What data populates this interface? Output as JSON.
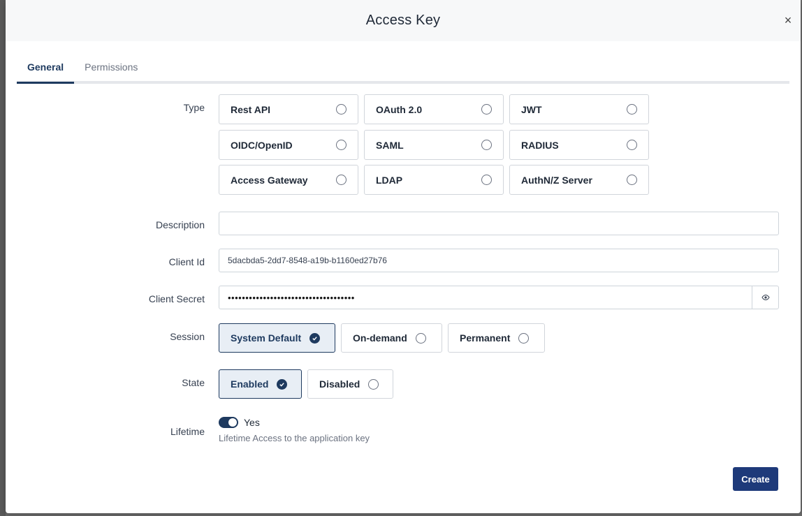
{
  "modal": {
    "title": "Access Key",
    "close": "×"
  },
  "tabs": [
    {
      "label": "General",
      "active": true
    },
    {
      "label": "Permissions",
      "active": false
    }
  ],
  "labels": {
    "type": "Type",
    "description": "Description",
    "client_id": "Client Id",
    "client_secret": "Client Secret",
    "session": "Session",
    "state": "State",
    "lifetime": "Lifetime"
  },
  "type_options": [
    "Rest API",
    "OAuth 2.0",
    "JWT",
    "OIDC/OpenID",
    "SAML",
    "RADIUS",
    "Access Gateway",
    "LDAP",
    "AuthN/Z Server"
  ],
  "fields": {
    "description": "",
    "client_id": "5dacbda5-2dd7-8548-a19b-b1160ed27b76",
    "client_secret": "••••••••••••••••••••••••••••••••••••"
  },
  "session_options": [
    {
      "label": "System Default",
      "selected": true
    },
    {
      "label": "On-demand",
      "selected": false
    },
    {
      "label": "Permanent",
      "selected": false
    }
  ],
  "state_options": [
    {
      "label": "Enabled",
      "selected": true
    },
    {
      "label": "Disabled",
      "selected": false
    }
  ],
  "lifetime": {
    "toggle_on": true,
    "toggle_label": "Yes",
    "hint": "Lifetime Access to the application key"
  },
  "actions": {
    "create": "Create"
  },
  "colors": {
    "accent": "#1e3a5f",
    "primary_button": "#1e3a7a",
    "selected_bg": "#e8eef5"
  }
}
